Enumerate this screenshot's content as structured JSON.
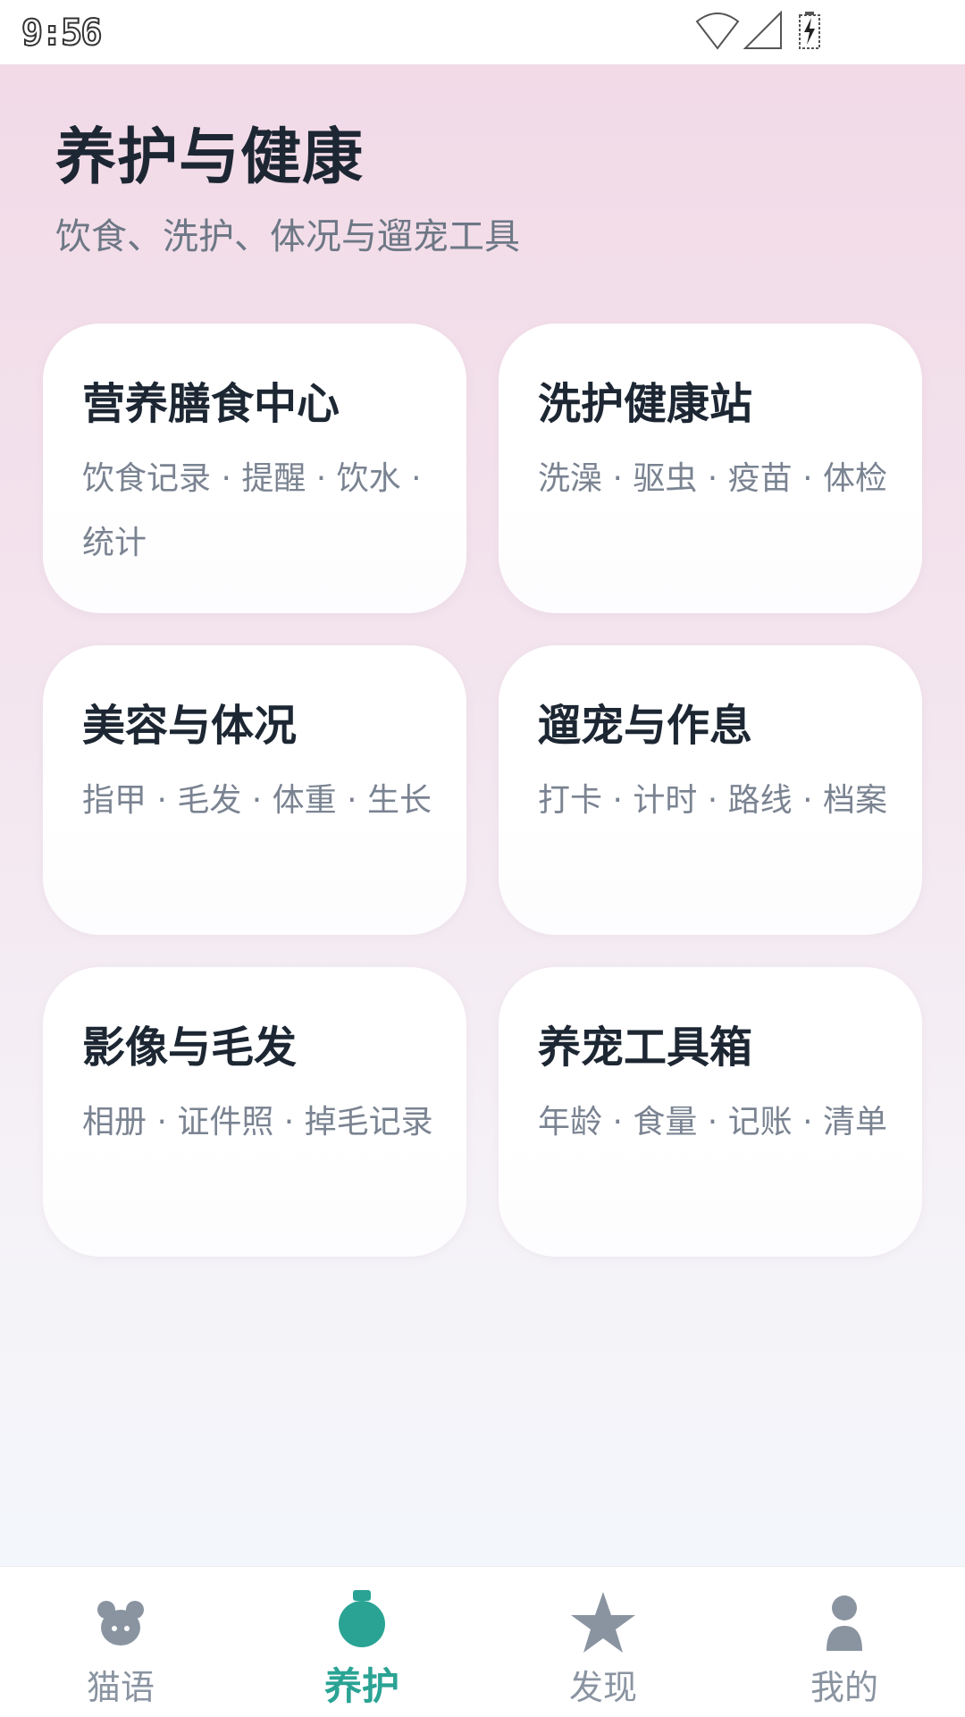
{
  "status_bar": {
    "time": "9:56"
  },
  "header": {
    "title": "养护与健康",
    "subtitle": "饮食、洗护、体况与遛宠工具"
  },
  "cards": [
    {
      "title": "营养膳食中心",
      "desc": "饮食记录 · 提醒 · 饮水 · 统计"
    },
    {
      "title": "洗护健康站",
      "desc": "洗澡 · 驱虫 · 疫苗 · 体检"
    },
    {
      "title": "美容与体况",
      "desc": "指甲 · 毛发 · 体重 · 生长"
    },
    {
      "title": "遛宠与作息",
      "desc": "打卡 · 计时 · 路线 · 档案"
    },
    {
      "title": "影像与毛发",
      "desc": "相册 · 证件照 · 掉毛记录"
    },
    {
      "title": "养宠工具箱",
      "desc": "年龄 · 食量 · 记账 · 清单"
    }
  ],
  "bottom_nav": {
    "items": [
      {
        "label": "猫语",
        "icon": "cat-face-icon"
      },
      {
        "label": "养护",
        "icon": "care-bag-icon",
        "active": true
      },
      {
        "label": "发现",
        "icon": "star-icon"
      },
      {
        "label": "我的",
        "icon": "user-icon"
      }
    ]
  },
  "colors": {
    "accent": "#2aa394",
    "inactive": "#8a94a1",
    "title": "#1d2733"
  }
}
